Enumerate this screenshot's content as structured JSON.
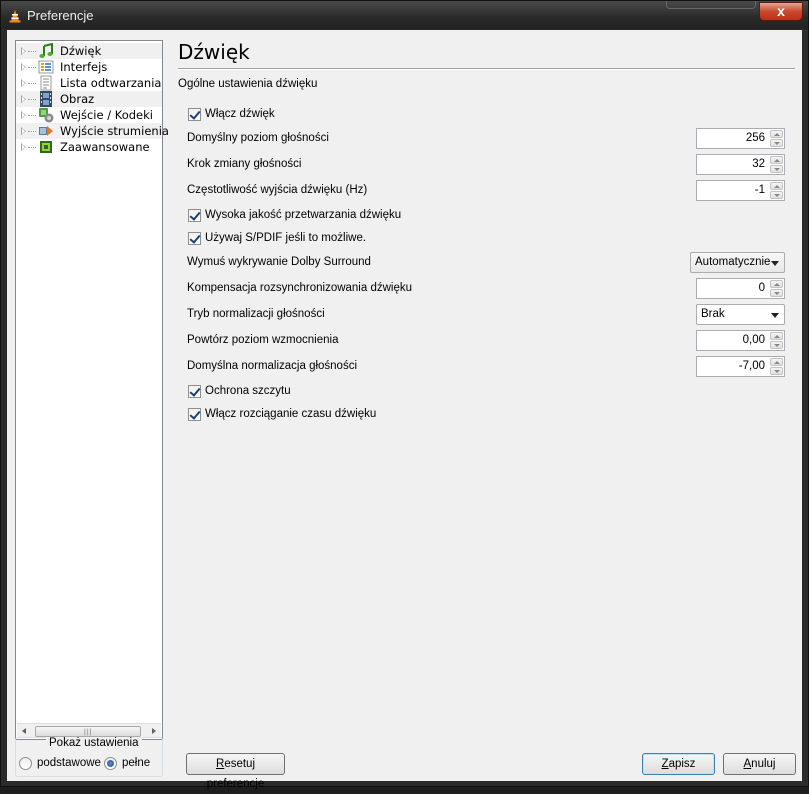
{
  "window": {
    "title": "Preferencje",
    "close_glyph": "x"
  },
  "tree": {
    "items": [
      {
        "label": "Dźwięk",
        "icon": "music-note-icon"
      },
      {
        "label": "Interfejs",
        "icon": "interface-icon"
      },
      {
        "label": "Lista odtwarzania",
        "icon": "playlist-icon"
      },
      {
        "label": "Obraz",
        "icon": "film-icon"
      },
      {
        "label": "Wejście / Kodeki",
        "icon": "codec-icon"
      },
      {
        "label": "Wyjście strumienia",
        "icon": "stream-output-icon"
      },
      {
        "label": "Zaawansowane",
        "icon": "chip-icon"
      }
    ]
  },
  "show_settings": {
    "title": "Pokaż ustawienia",
    "options": [
      {
        "label": "podstawowe",
        "selected": false
      },
      {
        "label": "pełne",
        "selected": true
      }
    ]
  },
  "panel": {
    "title": "Dźwięk",
    "section": "Ogólne ustawienia dźwięku",
    "rows": {
      "enable_audio": {
        "label": "Włącz dźwięk",
        "checked": true
      },
      "default_volume": {
        "label": "Domyślny poziom głośności",
        "value": "256"
      },
      "volume_step": {
        "label": "Krok zmiany głośności",
        "value": "32"
      },
      "frequency": {
        "label": "Częstotliwość wyjścia dźwięku (Hz)",
        "value": "-1"
      },
      "high_quality": {
        "label": "Wysoka jakość przetwarzania dźwięku",
        "checked": true
      },
      "spdif": {
        "label": "Używaj S/PDIF jeśli to możliwe.",
        "checked": true
      },
      "dolby": {
        "label": "Wymuś wykrywanie Dolby Surround",
        "value": "Automatycznie"
      },
      "desync": {
        "label": "Kompensacja rozsynchronizowania dźwięku",
        "value": "0"
      },
      "normalization_mode": {
        "label": "Tryb normalizacji głośności",
        "value": "Brak"
      },
      "replay_gain": {
        "label": "Powtórz poziom wzmocnienia",
        "value": "0,00"
      },
      "default_normalization": {
        "label": "Domyślna normalizacja głośności",
        "value": "-7,00"
      },
      "peak_protection": {
        "label": "Ochrona szczytu",
        "checked": true
      },
      "time_stretch": {
        "label": "Włącz rozciąganie czasu dźwięku",
        "checked": true
      }
    }
  },
  "buttons": {
    "reset": {
      "label_first": "R",
      "label_rest": "esetuj preferencje"
    },
    "save": {
      "label_first": "Z",
      "label_rest": "apisz"
    },
    "cancel": {
      "label_first": "A",
      "label_rest": "nuluj"
    }
  },
  "colors": {
    "accent": "#3c7fb1",
    "close": "#c9482c",
    "titlebar": "#2b2b2b"
  }
}
